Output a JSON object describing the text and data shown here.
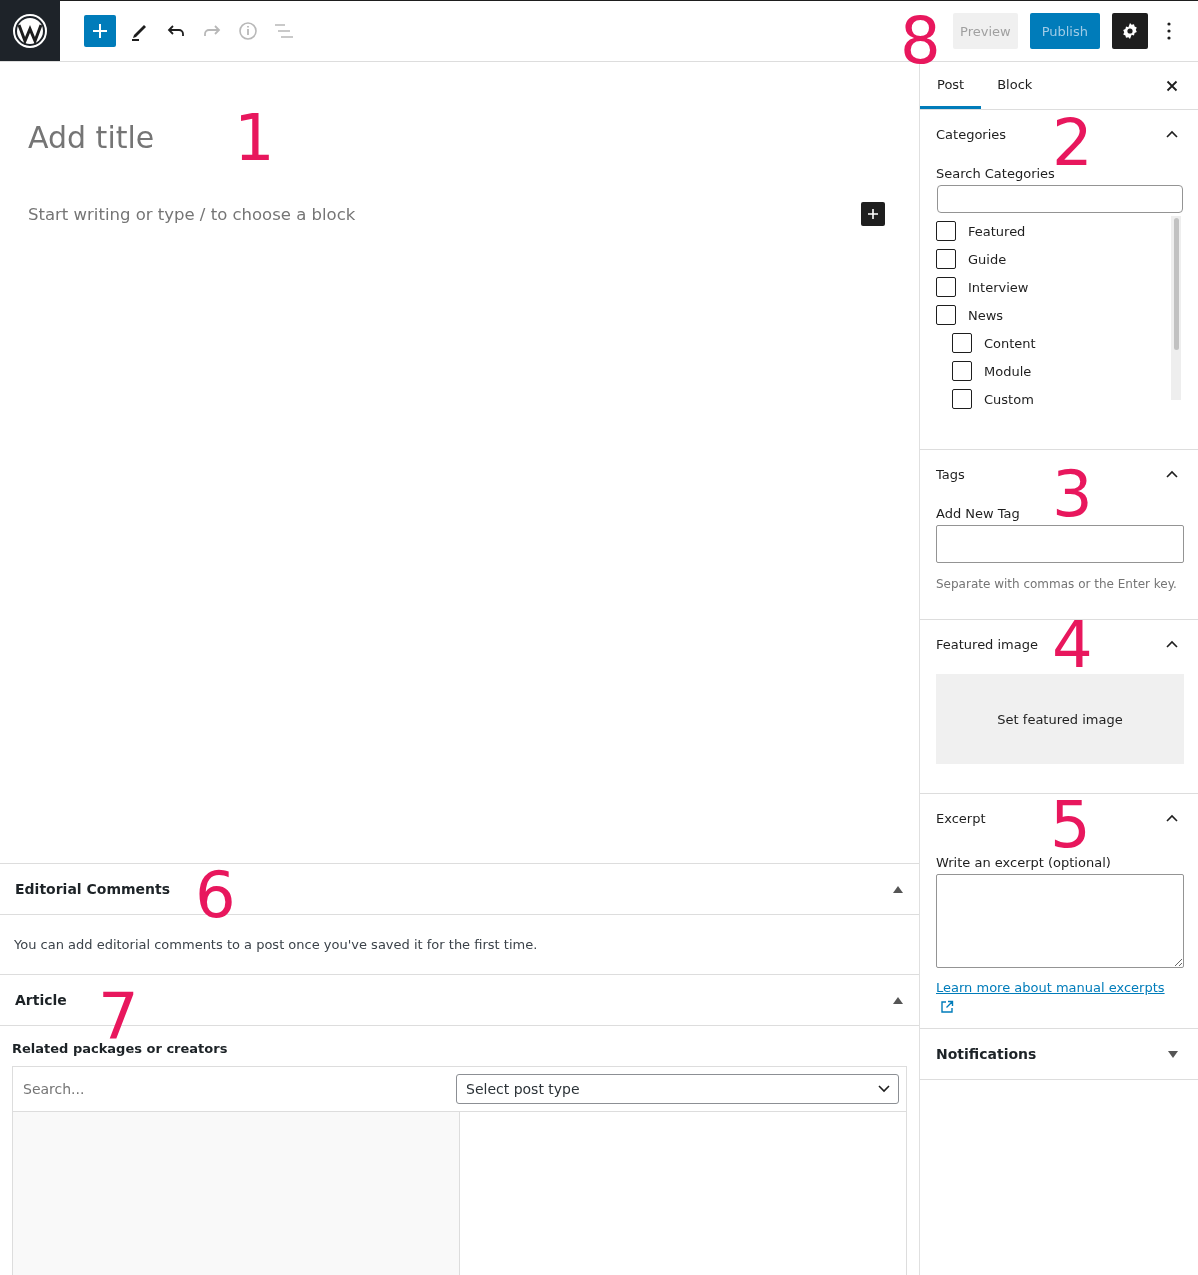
{
  "toolbar": {
    "tools": [
      {
        "kind": "add"
      },
      {
        "kind": "edit",
        "disabled": false
      },
      {
        "kind": "undo",
        "disabled": false
      },
      {
        "kind": "redo",
        "disabled": true
      },
      {
        "kind": "info",
        "disabled": true
      },
      {
        "kind": "outline",
        "disabled": true
      }
    ],
    "preview": {
      "label": "Preview",
      "disabled": true
    },
    "publish": {
      "label": "Publish",
      "disabled": true
    },
    "settings": {
      "on": true
    }
  },
  "editor": {
    "title_placeholder": "Add title",
    "block_placeholder": "Start writing or type / to choose a block"
  },
  "meta_boxes": [
    {
      "title": "Editorial Comments",
      "expanded": true,
      "kind": "text",
      "text": "You can add editorial comments to a post once you've saved it for the first time."
    },
    {
      "title": "Article",
      "expanded": true,
      "kind": "related",
      "label": "Related packages or creators",
      "search_placeholder": "Search...",
      "select_value": "Select post type"
    }
  ],
  "sidebar": {
    "tabs": [
      {
        "label": "Post",
        "selected": true
      },
      {
        "label": "Block",
        "selected": false
      }
    ],
    "panels": [
      {
        "kind": "categories",
        "title": "Categories",
        "expanded": true,
        "search_label": "Search Categories",
        "items": [
          {
            "label": "Featured",
            "checked": false
          },
          {
            "label": "Guide",
            "checked": false
          },
          {
            "label": "Interview",
            "checked": false
          },
          {
            "label": "News",
            "checked": false,
            "children": [
              {
                "label": "Content",
                "checked": false
              },
              {
                "label": "Module",
                "checked": false
              },
              {
                "label": "Custom",
                "checked": false
              }
            ]
          }
        ]
      },
      {
        "kind": "tags",
        "title": "Tags",
        "expanded": true,
        "field_label": "Add New Tag",
        "help": "Separate with commas or the Enter key."
      },
      {
        "kind": "image",
        "title": "Featured image",
        "expanded": true,
        "button": "Set featured image"
      },
      {
        "kind": "excerpt",
        "title": "Excerpt",
        "expanded": true,
        "field_label": "Write an excerpt (optional)",
        "link": "Learn more about manual excerpts"
      },
      {
        "kind": "plugin",
        "title": "Notifications",
        "expanded": false
      }
    ]
  },
  "annotations": [
    "1",
    "2",
    "3",
    "4",
    "5",
    "6",
    "7",
    "8"
  ]
}
